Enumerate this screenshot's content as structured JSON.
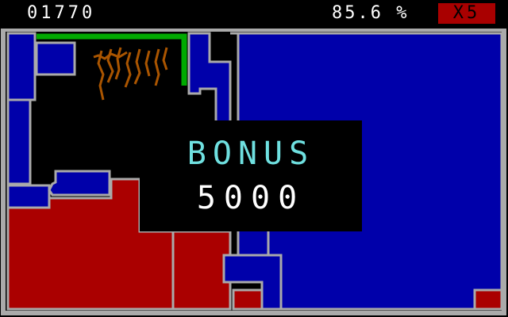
{
  "hud": {
    "score": "01770",
    "claimed_percent": "85.6 %",
    "lives": "X5"
  },
  "bonus": {
    "label": "BONUS",
    "value": "5000"
  },
  "colors": {
    "border": "#aaaaaa",
    "claimed_blue": "#0000aa",
    "claimed_red": "#aa0000",
    "trail_green": "#00aa00",
    "qix": "#aa5500",
    "bonus_label": "#6fe0e0",
    "lives_bg": "#a90000"
  },
  "icons": {
    "qix_enemy": "qix-icon"
  }
}
